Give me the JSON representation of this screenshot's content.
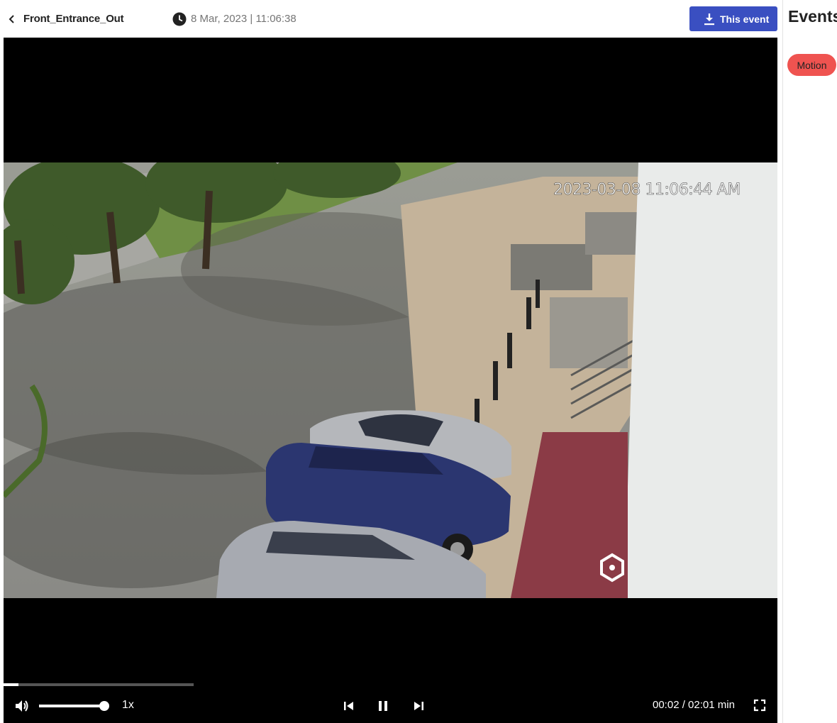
{
  "header": {
    "camera_name": "Front_Entrance_Out",
    "timestamp": "8 Mar, 2023 | 11:06:38",
    "download_label": "This event"
  },
  "sidebar": {
    "title": "Events",
    "events": [
      {
        "label": "Motion",
        "color": "#ef5350"
      }
    ]
  },
  "player": {
    "osd_timestamp": "2023-03-08 11:06:44 AM",
    "speed": "1x",
    "time_readout": "00:02 / 02:01 min",
    "progress": 0.08,
    "volume": 0.98,
    "state": "playing"
  },
  "icons": {
    "back": "chevron-left-icon",
    "clock": "clock-icon",
    "download": "download-icon",
    "volume": "volume-icon",
    "prev": "skip-previous-icon",
    "pause": "pause-icon",
    "next": "skip-next-icon",
    "fullscreen": "fullscreen-icon"
  },
  "colors": {
    "accent": "#3a4fc1",
    "motion_badge": "#ef5350"
  }
}
